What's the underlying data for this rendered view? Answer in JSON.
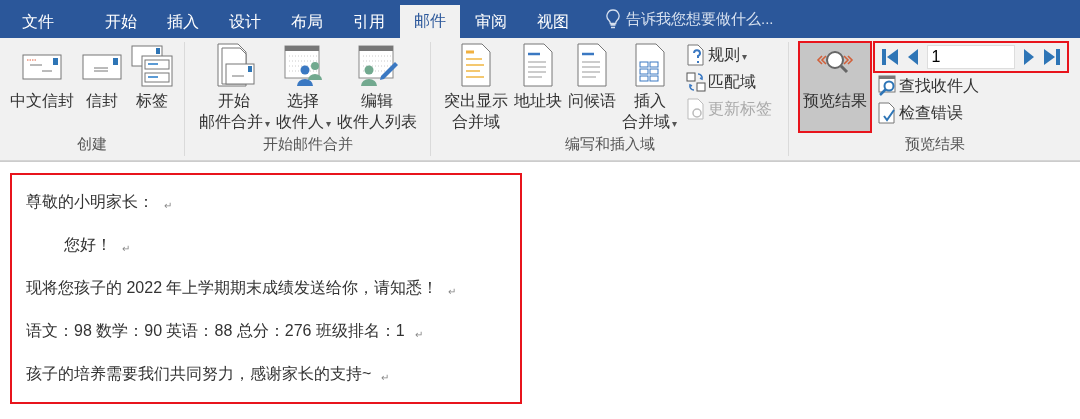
{
  "tabs": [
    {
      "label": "文件",
      "selected": false
    },
    {
      "label": "开始",
      "selected": false
    },
    {
      "label": "插入",
      "selected": false
    },
    {
      "label": "设计",
      "selected": false
    },
    {
      "label": "布局",
      "selected": false
    },
    {
      "label": "引用",
      "selected": false
    },
    {
      "label": "邮件",
      "selected": true
    },
    {
      "label": "审阅",
      "selected": false
    },
    {
      "label": "视图",
      "selected": false
    }
  ],
  "tell_me": "告诉我您想要做什么...",
  "groups": [
    {
      "label": "创建",
      "items": [
        {
          "kind": "large",
          "lines": [
            "中文信封"
          ]
        },
        {
          "kind": "large",
          "lines": [
            "信封"
          ]
        },
        {
          "kind": "large",
          "lines": [
            "标签"
          ]
        }
      ]
    },
    {
      "label": "开始邮件合并",
      "items": [
        {
          "kind": "large",
          "lines": [
            "开始",
            "邮件合并"
          ],
          "caret": "▾"
        },
        {
          "kind": "large",
          "lines": [
            "选择",
            "收件人"
          ],
          "caret": "▾"
        },
        {
          "kind": "large",
          "lines": [
            "编辑",
            "收件人列表"
          ]
        }
      ]
    },
    {
      "label": "编写和插入域",
      "items": [
        {
          "kind": "large",
          "lines": [
            "突出显示",
            "合并域"
          ]
        },
        {
          "kind": "large",
          "lines": [
            "地址块"
          ]
        },
        {
          "kind": "large",
          "lines": [
            "问候语"
          ]
        },
        {
          "kind": "large",
          "lines": [
            "插入",
            "合并域"
          ],
          "caret": "▾"
        },
        {
          "kind": "smallstack",
          "buttons": [
            {
              "label": "规则",
              "caret": "▾",
              "disabled": false
            },
            {
              "label": "匹配域",
              "disabled": false
            },
            {
              "label": "更新标签",
              "disabled": true
            }
          ]
        }
      ]
    },
    {
      "label": "预览结果",
      "items": [
        {
          "kind": "toggle",
          "lines": [
            "预览结果"
          ],
          "on": true,
          "highlighted": true
        },
        {
          "kind": "navstack",
          "nav": {
            "value": "1",
            "highlighted": true
          },
          "buttons": [
            {
              "label": "查找收件人",
              "disabled": false
            },
            {
              "label": "检查错误",
              "disabled": false
            }
          ]
        }
      ]
    }
  ],
  "document": {
    "highlighted": true,
    "paragraphs": [
      {
        "text": "尊敬的小明家长：",
        "indented": false,
        "mark": "↵"
      },
      {
        "text": "您好！",
        "indented": true,
        "mark": "↵"
      },
      {
        "text": "现将您孩子的 2022 年上学期期末成绩发送给你，请知悉！",
        "indented": false,
        "mark": "↵"
      },
      {
        "text": "语文：98  数学：90  英语：88  总分：276  班级排名：1",
        "indented": false,
        "mark": "↵"
      },
      {
        "text": "孩子的培养需要我们共同努力，感谢家长的支持~",
        "indented": false,
        "mark": "↵"
      }
    ]
  }
}
